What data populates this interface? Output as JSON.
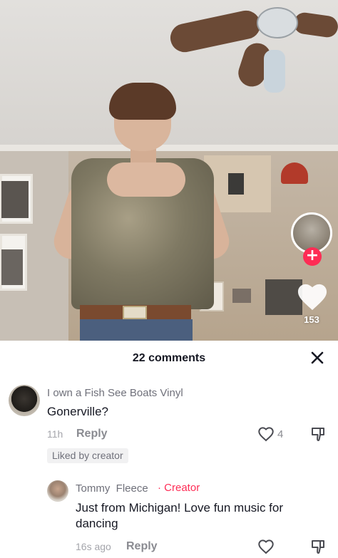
{
  "video": {
    "like_count": "153",
    "follow_symbol": "+"
  },
  "comments_panel": {
    "title": "22 comments",
    "close_symbol": "✕"
  },
  "comments": [
    {
      "username": "I own a Fish See Boats Vinyl",
      "text": "Gonerville?",
      "time": "11h",
      "reply_label": "Reply",
      "like_count": "4",
      "badge": "Liked by creator"
    },
    {
      "username": "Tommy  Fleece",
      "creator_separator": "·",
      "creator_label": "Creator",
      "text": "Just from Michigan! Love fun music for dancing",
      "time": "16s ago",
      "reply_label": "Reply"
    }
  ],
  "colors": {
    "accent": "#fe2c55",
    "text_primary": "#161823",
    "text_secondary": "#8a8b91"
  },
  "icons": [
    "heart-icon",
    "dislike-icon",
    "close-icon",
    "plus-icon"
  ]
}
